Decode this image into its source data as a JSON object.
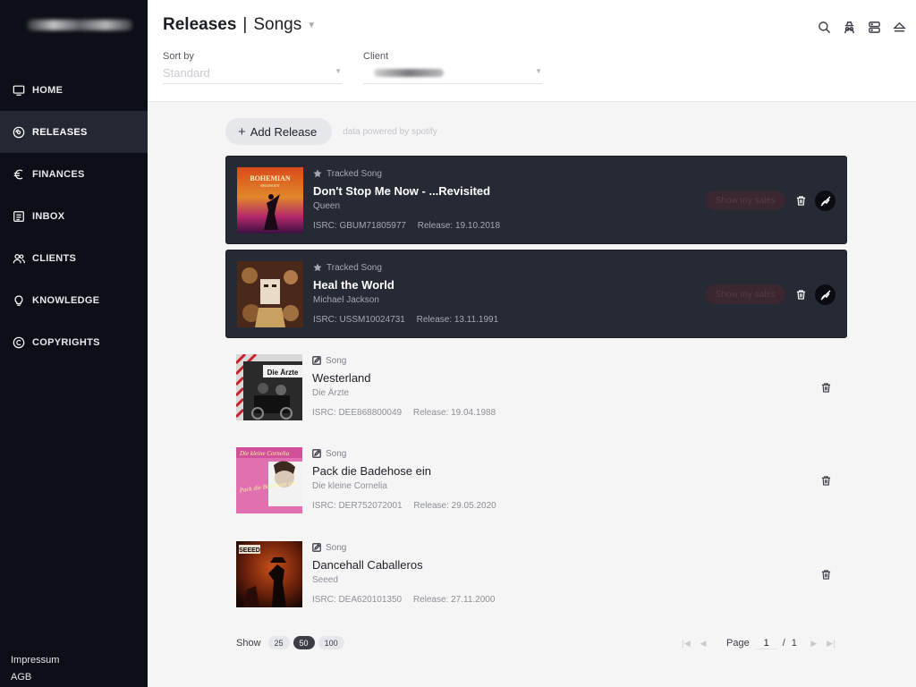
{
  "sidebar": {
    "items": [
      {
        "label": "HOME",
        "icon": "monitor-icon"
      },
      {
        "label": "RELEASES",
        "icon": "disc-icon"
      },
      {
        "label": "FINANCES",
        "icon": "euro-icon"
      },
      {
        "label": "INBOX",
        "icon": "inbox-icon"
      },
      {
        "label": "CLIENTS",
        "icon": "users-icon"
      },
      {
        "label": "KNOWLEDGE",
        "icon": "lightbulb-icon"
      },
      {
        "label": "COPYRIGHTS",
        "icon": "copyright-icon"
      }
    ],
    "footer": {
      "impressum": "Impressum",
      "agb": "AGB"
    }
  },
  "header": {
    "title_main": "Releases",
    "title_separator": "|",
    "title_sub": "Songs",
    "sort_label": "Sort by",
    "sort_value": "Standard",
    "client_label": "Client",
    "icons": [
      "search-icon",
      "spy-icon",
      "server-icon",
      "eject-icon"
    ]
  },
  "toolbar": {
    "add_label": "Add Release",
    "powered": "data powered by spotify"
  },
  "releases": [
    {
      "kind": "Tracked Song",
      "title": "Don't Stop Me Now - ...Revisited",
      "artist": "Queen",
      "isrc": "ISRC: GBUM71805977",
      "release": "Release: 19.10.2018",
      "sales_label": "Show my sales",
      "tracked": true
    },
    {
      "kind": "Tracked Song",
      "title": "Heal the World",
      "artist": "Michael Jackson",
      "isrc": "ISRC: USSM10024731",
      "release": "Release: 13.11.1991",
      "sales_label": "Show my sales",
      "tracked": true
    },
    {
      "kind": "Song",
      "title": "Westerland",
      "artist": "Die Ärzte",
      "isrc": "ISRC: DEE868800049",
      "release": "Release: 19.04.1988",
      "tracked": false
    },
    {
      "kind": "Song",
      "title": "Pack die Badehose ein",
      "artist": "Die kleine Cornelia",
      "isrc": "ISRC: DER752072001",
      "release": "Release: 29.05.2020",
      "tracked": false
    },
    {
      "kind": "Song",
      "title": "Dancehall Caballeros",
      "artist": "Seeed",
      "isrc": "ISRC: DEA620101350",
      "release": "Release: 27.11.2000",
      "tracked": false
    }
  ],
  "covers": {
    "c0_text": "BOHEMIAN",
    "c0_sub": "RHAPSODY",
    "c2_text": "Die Ärzte",
    "c3_text": "Die kleine Cornelia",
    "c3_sub": "Pack die Badehose ein",
    "c4_text": "SEEED"
  },
  "pagination": {
    "show_label": "Show",
    "sizes": [
      "25",
      "50",
      "100"
    ],
    "active_size": "50",
    "page_label": "Page",
    "page_value": "1",
    "slash": "/",
    "total": "1"
  }
}
